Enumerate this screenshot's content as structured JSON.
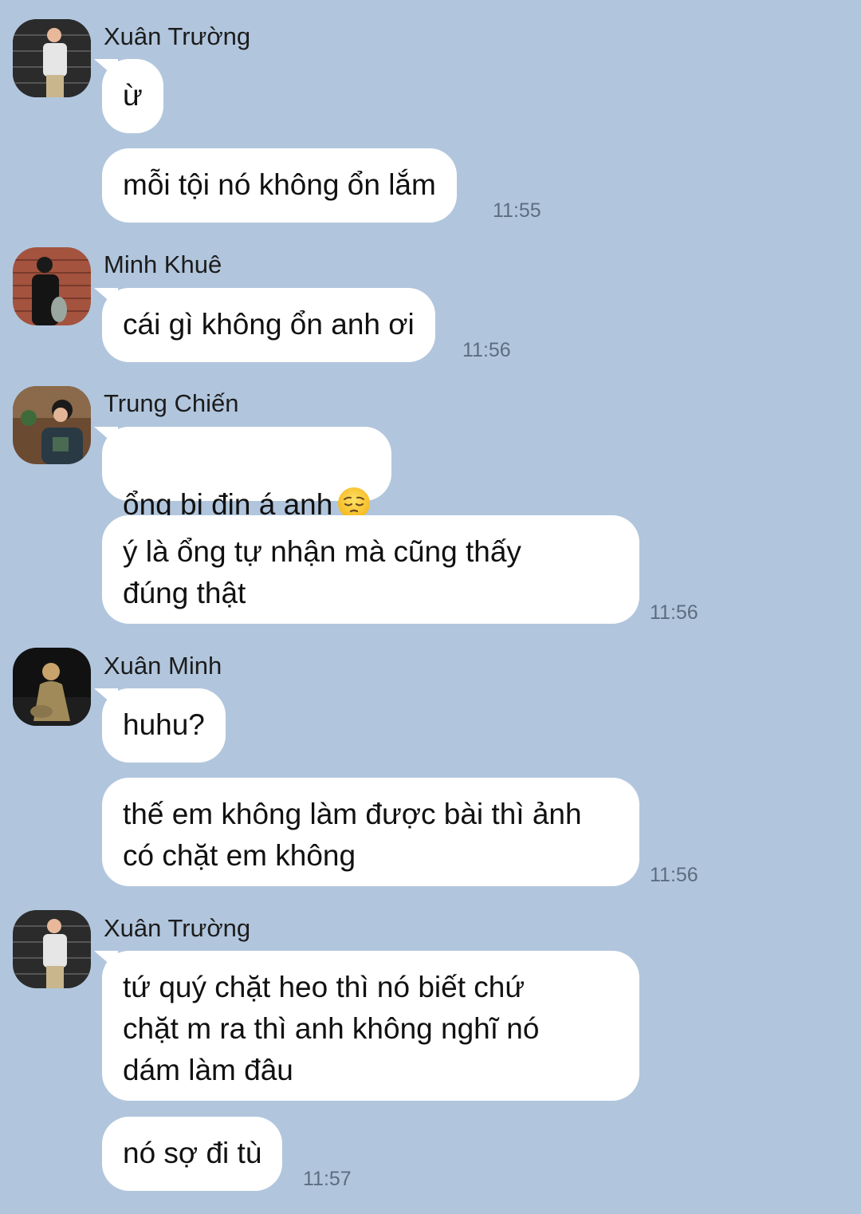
{
  "messages": [
    {
      "sender": "Xuân Trường",
      "avatar_icon": "avatar-xuan-truong",
      "bubbles": [
        "ừ",
        "mỗi tội nó không ổn lắm"
      ],
      "time": "11:55"
    },
    {
      "sender": "Minh Khuê",
      "avatar_icon": "avatar-minh-khue",
      "bubbles": [
        "cái gì không ổn anh ơi"
      ],
      "time": "11:56"
    },
    {
      "sender": "Trung Chiến",
      "avatar_icon": "avatar-trung-chien",
      "bubbles": [
        "ổng bị đin á anh",
        "ý là ổng tự nhận mà cũng thấy\nđúng thật"
      ],
      "emoji": "pensive-face-emoji",
      "time": "11:56"
    },
    {
      "sender": "Xuân Minh",
      "avatar_icon": "avatar-xuan-minh",
      "bubbles": [
        "huhu?",
        "thế em không làm được bài thì ảnh\ncó chặt em không"
      ],
      "time": "11:56"
    },
    {
      "sender": "Xuân Trường",
      "avatar_icon": "avatar-xuan-truong",
      "bubbles": [
        "tứ quý chặt heo thì nó biết chứ\nchặt m ra thì anh không nghĩ nó\ndám làm đâu",
        "nó sợ đi tù"
      ],
      "time": "11:57"
    }
  ],
  "colors": {
    "background": "#b1c6dd",
    "bubble": "#ffffff",
    "timestamp": "#5d6d80"
  }
}
